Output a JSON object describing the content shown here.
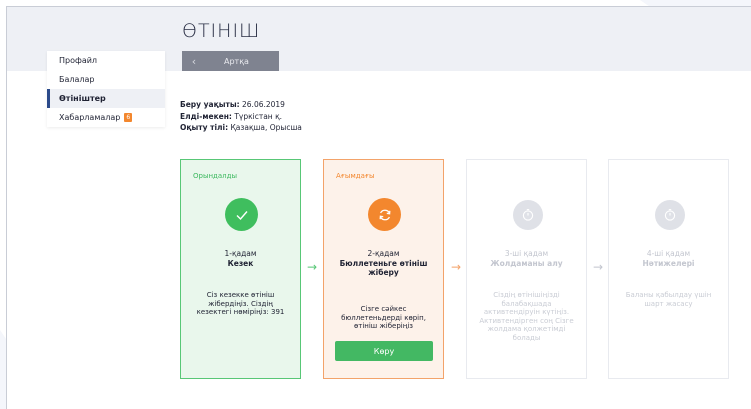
{
  "page": {
    "title": "ӨТІНІШ"
  },
  "toolbar": {
    "back_label": "Артқа",
    "back_icon": "‹"
  },
  "sidebar": {
    "items": [
      {
        "label": "Профайл",
        "active": false
      },
      {
        "label": "Балалар",
        "active": false
      },
      {
        "label": "Өтініштер",
        "active": true
      },
      {
        "label": "Хабарламалар",
        "active": false,
        "badge": "6"
      }
    ]
  },
  "info": {
    "date_label": "Беру уақыты:",
    "date_value": "26.06.2019",
    "place_label": "Елді-мекен:",
    "place_value": "Түркістан қ.",
    "lang_label": "Оқыту тілі:",
    "lang_value": "Қазақша, Орысша"
  },
  "steps": [
    {
      "status": "Орындалды",
      "num": "1-қадам",
      "name": "Кезек",
      "desc": "Сіз кезекке өтініш жібердіңіз. Сіздің кезектегі нөміріңіз: 391",
      "icon": "check-icon"
    },
    {
      "status": "Ағымдағы",
      "num": "2-қадам",
      "name": "Бюллетеньге өтініш жіберу",
      "desc": "Сізге сәйкес бюллетеньдерді көріп, өтініш жіберіңіз",
      "button": "Көру",
      "icon": "refresh-icon"
    },
    {
      "status": "",
      "num": "3-ші қадам",
      "name": "Жолдаманы алу",
      "desc": "Сіздің өтінішіңізді балабақшада активтендіруін күтіңіз. Активтендірген соң Сізге жолдама қолжетімді болады",
      "icon": "timer-icon"
    },
    {
      "status": "",
      "num": "4-ші қадам",
      "name": "Нәтижелері",
      "desc": "Баланы қабылдау үшін шарт жасасу",
      "icon": "timer-icon"
    }
  ],
  "colors": {
    "done": "#3fbe5e",
    "current": "#f3872e",
    "pending": "#dfe1e7",
    "accent": "#2b4a8a"
  }
}
